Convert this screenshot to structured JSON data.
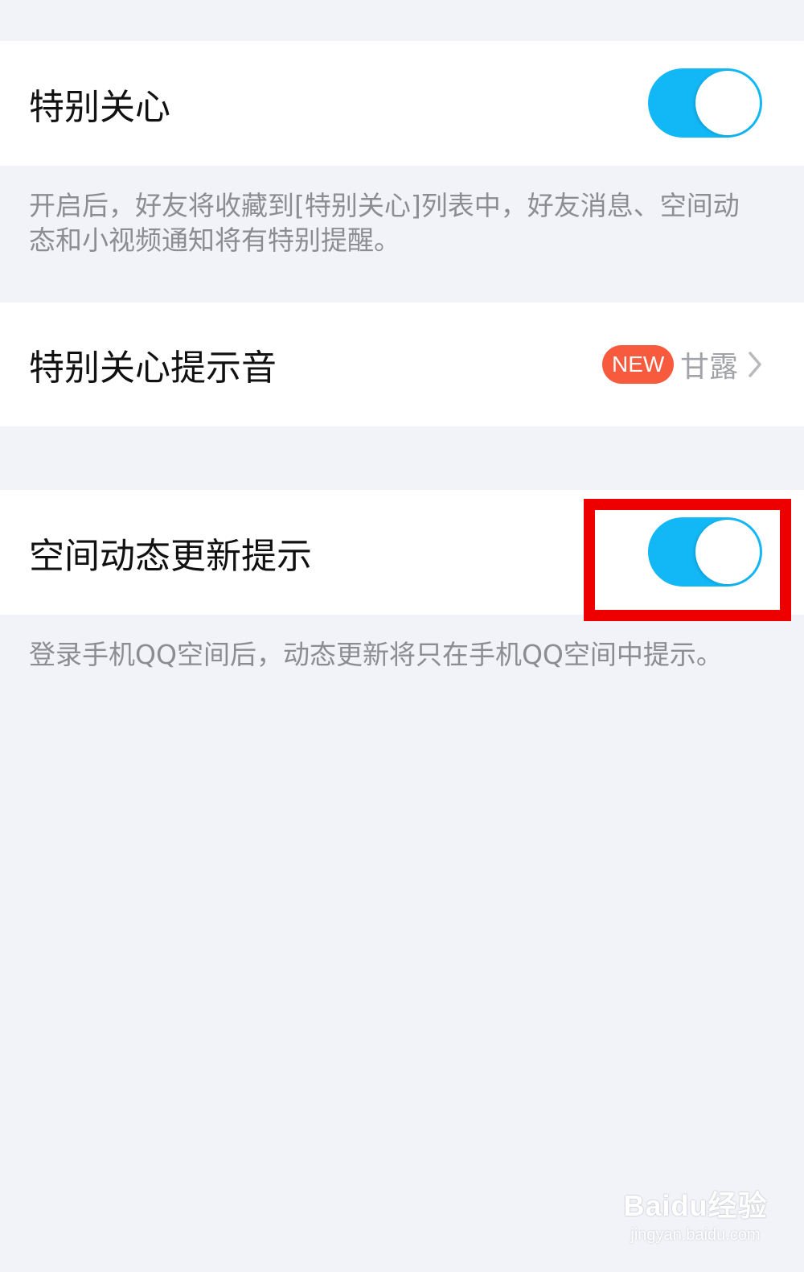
{
  "colors": {
    "page_background": "#f2f3f8",
    "toggle_on": "#12b7f5",
    "new_badge": "#f85a3d",
    "highlight": "#ee0000"
  },
  "special_care": {
    "label": "特别关心",
    "enabled": true,
    "description": "开启后，好友将收藏到[特别关心]列表中，好友消息、空间动态和小视频通知将有特别提醒。"
  },
  "special_care_sound": {
    "label": "特别关心提示音",
    "badge": "NEW",
    "value": "甘露",
    "chevron_icon": "chevron-right-icon"
  },
  "qzone_update": {
    "label": "空间动态更新提示",
    "enabled": true,
    "description": "登录手机QQ空间后，动态更新将只在手机QQ空间中提示。"
  },
  "watermark": {
    "brand": "Baidu经验",
    "url": "jingyan.baidu.com"
  }
}
